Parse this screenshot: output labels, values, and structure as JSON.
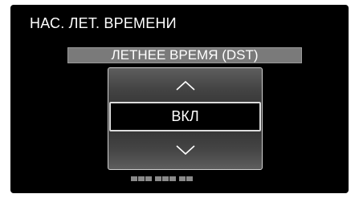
{
  "screen": {
    "title": "НАС. ЛЕТ. ВРЕМЕНИ",
    "subtitle": "ЛЕТНЕЕ ВРЕМЯ (DST)",
    "selector": {
      "up_icon": "chevron-up-icon",
      "value": "ВКЛ",
      "down_icon": "chevron-down-icon"
    }
  },
  "colors": {
    "background": "#000000",
    "text": "#ffffff",
    "subtitle_bar": "#7a7a7a",
    "selector_border": "#d0d0d0"
  }
}
